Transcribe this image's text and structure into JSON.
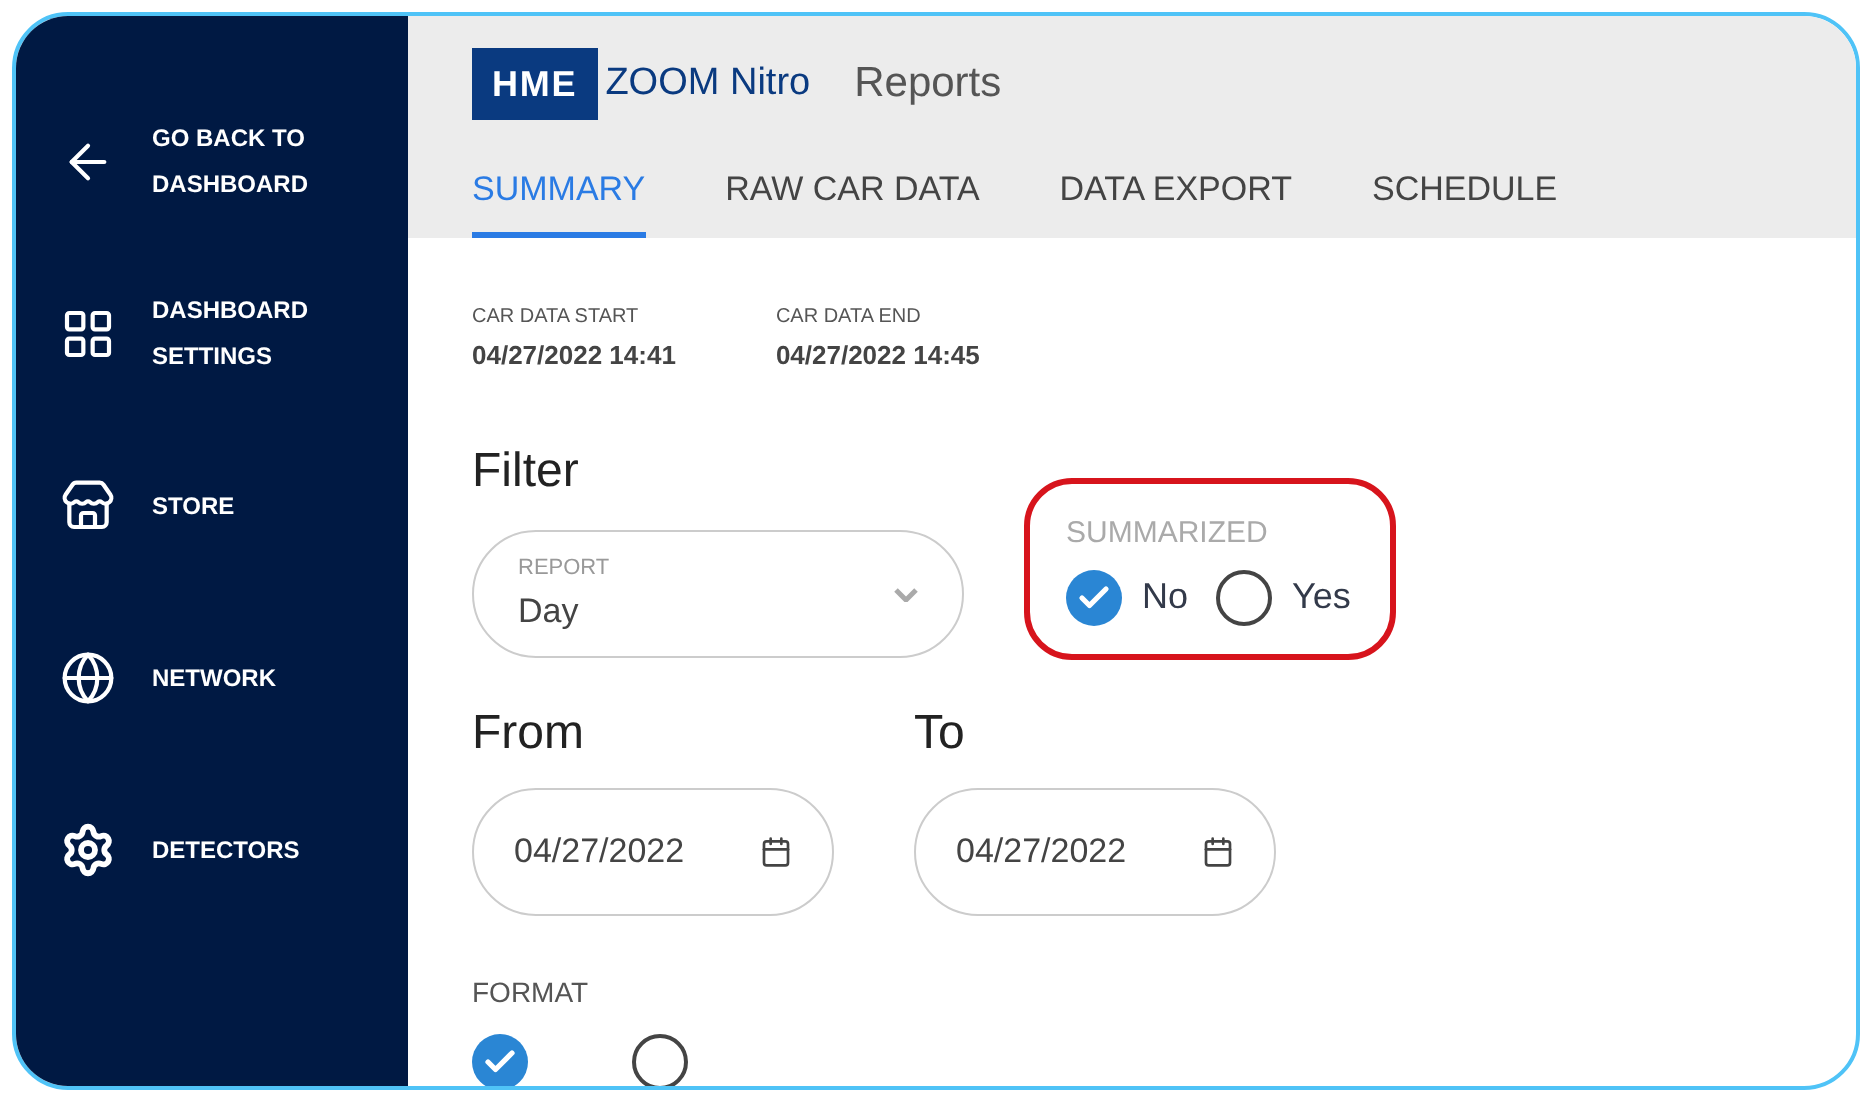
{
  "sidebar": {
    "items": [
      {
        "kind": "back",
        "label": "GO BACK TO DASHBOARD"
      },
      {
        "kind": "grid",
        "label": "DASHBOARD SETTINGS"
      },
      {
        "kind": "store",
        "label": "STORE"
      },
      {
        "kind": "network",
        "label": "NETWORK"
      },
      {
        "kind": "gear",
        "label": "DETECTORS"
      }
    ]
  },
  "header": {
    "logo_badge": "HME",
    "logo_text": "ZOOM Nitro",
    "title": "Reports"
  },
  "tabs": [
    {
      "label": "SUMMARY",
      "selected": true
    },
    {
      "label": "RAW CAR DATA",
      "selected": false
    },
    {
      "label": "DATA EXPORT",
      "selected": false
    },
    {
      "label": "SCHEDULE",
      "selected": false
    }
  ],
  "car_data": [
    {
      "label": "CAR DATA START",
      "value": "04/27/2022 14:41"
    },
    {
      "label": "CAR DATA END",
      "value": "04/27/2022 14:45"
    }
  ],
  "filter": {
    "heading": "Filter",
    "report": {
      "label": "REPORT",
      "value": "Day"
    },
    "summarized": {
      "label": "SUMMARIZED",
      "highlighted": true,
      "options": [
        {
          "label": "No",
          "selected": true
        },
        {
          "label": "Yes",
          "selected": false
        }
      ]
    }
  },
  "dates": [
    {
      "heading": "From",
      "value": "04/27/2022"
    },
    {
      "heading": "To",
      "value": "04/27/2022"
    }
  ],
  "format": {
    "label": "FORMAT",
    "options": [
      {
        "selected": true
      },
      {
        "selected": false
      }
    ]
  }
}
